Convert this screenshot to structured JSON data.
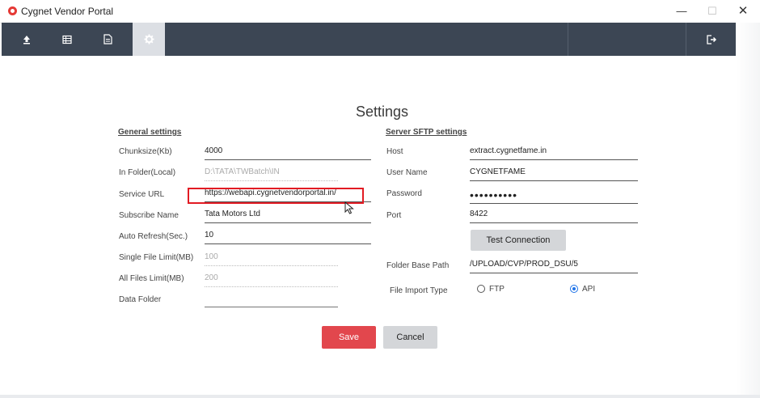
{
  "window": {
    "title": "Cygnet Vendor Portal",
    "minimize": "—",
    "maximize": "☐",
    "close": "✕"
  },
  "toolbar": {
    "items": [
      {
        "name": "upload-icon"
      },
      {
        "name": "table-icon"
      },
      {
        "name": "document-icon"
      },
      {
        "name": "gear-icon",
        "active": true
      }
    ],
    "logout": {
      "name": "logout-icon"
    }
  },
  "page": {
    "title": "Settings"
  },
  "general": {
    "title": "General settings",
    "chunksize": {
      "label": "Chunksize(Kb)",
      "value": "4000"
    },
    "in_folder": {
      "label": "In Folder(Local)",
      "value": "D:\\TATA\\TWBatch\\IN"
    },
    "service_url": {
      "label": "Service URL",
      "value": "https://webapi.cygnetvendorportal.in/"
    },
    "subscribe_name": {
      "label": "Subscribe Name",
      "value": "Tata Motors Ltd"
    },
    "auto_refresh": {
      "label": "Auto Refresh(Sec.)",
      "value": "10"
    },
    "single_file_limit": {
      "label": "Single File Limit(MB)",
      "value": "100"
    },
    "all_files_limit": {
      "label": "All Files Limit(MB)",
      "value": "200"
    },
    "data_folder": {
      "label": "Data Folder",
      "value": ""
    }
  },
  "sftp": {
    "title": "Server SFTP settings",
    "host": {
      "label": "Host",
      "value": "extract.cygnetfame.in"
    },
    "user_name": {
      "label": "User Name",
      "value": "CYGNETFAME"
    },
    "password": {
      "label": "Password",
      "value": "••••••••••"
    },
    "port": {
      "label": "Port",
      "value": "8422"
    },
    "test_connection": "Test Connection",
    "folder_base_path": {
      "label": "Folder Base Path",
      "value": "/UPLOAD/CVP/PROD_DSU/5"
    },
    "file_import_type": {
      "label": "File Import Type",
      "options": [
        {
          "label": "FTP",
          "checked": false
        },
        {
          "label": "API",
          "checked": true
        }
      ]
    }
  },
  "actions": {
    "save": "Save",
    "cancel": "Cancel"
  },
  "colors": {
    "toolbar_bg": "#3c4654",
    "save_bg": "#e2474d",
    "highlight": "#e21b23",
    "radio_accent": "#1e73e8"
  }
}
